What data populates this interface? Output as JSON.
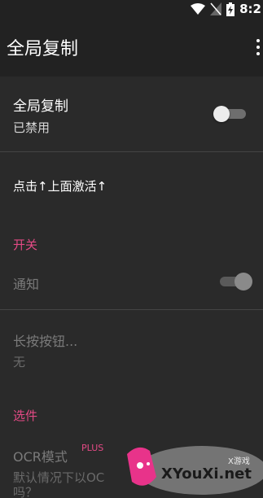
{
  "status_bar": {
    "time": "8:2"
  },
  "app_bar": {
    "title": "全局复制"
  },
  "main_toggle": {
    "title": "全局复制",
    "subtitle": "已禁用",
    "enabled": false
  },
  "activate_hint": "点击↑上面激活↑",
  "sections": {
    "switches": {
      "header": "开关",
      "notification_label": "通知",
      "notification_enabled": true
    },
    "long_press": {
      "title": "长按按钮...",
      "value": "无"
    },
    "options": {
      "header": "选件",
      "ocr_title": "OCR模式",
      "ocr_badge": "PLUS",
      "ocr_desc_line1": "默认情况下以OC",
      "ocr_desc_line2": "吗？"
    }
  },
  "watermark": {
    "text": "XYouXi.net",
    "small": "X游戏"
  },
  "colors": {
    "accent": "#e34a85",
    "background": "#2a2a2a",
    "app_bar": "#222222"
  }
}
